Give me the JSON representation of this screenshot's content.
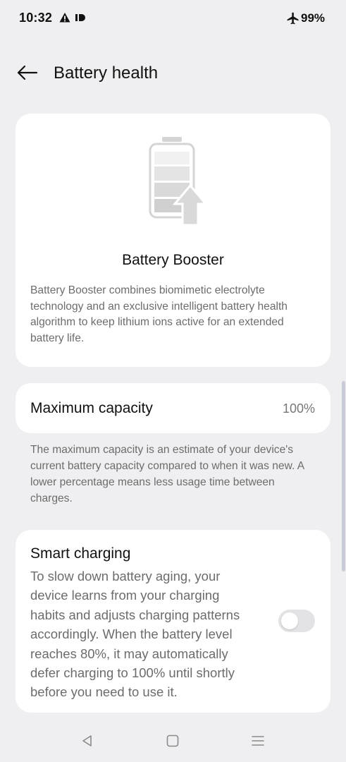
{
  "status_bar": {
    "time": "10:32",
    "battery_percent": "99%",
    "icons": [
      "warning-icon",
      "id-icon",
      "airplane-icon"
    ]
  },
  "app_bar": {
    "title": "Battery health",
    "back_icon": "arrow-left-icon"
  },
  "booster": {
    "title": "Battery Booster",
    "description": "Battery Booster combines biomimetic electrolyte technology and an exclusive intelligent battery health algorithm to keep lithium ions active for an extended battery life.",
    "icon": "battery-booster-icon"
  },
  "capacity": {
    "label": "Maximum capacity",
    "value": "100%",
    "note": "The maximum capacity is an estimate of your device's current battery capacity compared to when it was new. A lower percentage means less usage time between charges."
  },
  "smart_charging": {
    "title": "Smart charging",
    "description": "To slow down battery aging, your device learns from your charging habits and adjusts charging patterns accordingly. When the battery level reaches 80%, it may automatically defer charging to 100% until shortly before you need to use it.",
    "enabled": false
  },
  "nav_bar": {
    "buttons": [
      "back-triangle-icon",
      "home-square-icon",
      "menu-lines-icon"
    ]
  },
  "colors": {
    "background": "#efeff1",
    "card": "#ffffff",
    "secondary_text": "#6c6c6c",
    "toggle_off": "#e3e3e5"
  }
}
